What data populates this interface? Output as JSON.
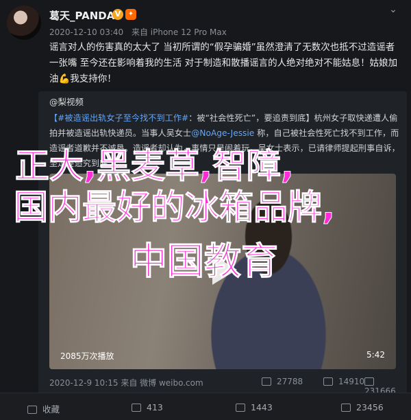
{
  "post": {
    "username": "葛天_PANDA",
    "verified_badge": "V",
    "level_badge": "✦",
    "time": "2020-12-10 03:40",
    "source": "来自 iPhone 12 Pro Max",
    "text": "谣言对人的伤害真的太大了 当初所谓的“假孕骗婚”虽然澄清了无数次也抵不过造谣者一张嘴 至今还在影响着我的生活 对于制造和散播谣言的人绝对绝对不能姑息！姑娘加油💪我支持你！"
  },
  "retweet": {
    "user": "@梨视频",
    "text_tag": "【#被造谣出轨女子至今找不到工作#",
    "text_body": "：被“社会性死亡”，要追责到底】杭州女子取快递遭人偷拍并被造谣出轨快递员。当事人吴女士",
    "mention": "@NoAge-Jessie",
    "text_rest": " 称，自己被社会性死亡找不到工作，而造谣者道歉并不诚恳。造谣者却认为，事情只是闹着玩。吴女士表示，已请律师提起刑事自诉，坚定要追究到底",
    "video": {
      "views": "2085万次播放",
      "duration": "5:42"
    },
    "time": "2020-12-9 10:15 来自 微博 weibo.com",
    "reposts": "27788",
    "comments": "14910",
    "likes": "231666"
  },
  "overlay": {
    "line1": "正大,黑麦草,智障,",
    "line2": "国内最好的冰箱品牌,",
    "line3": "中国教育"
  },
  "actions": {
    "repost": "收藏",
    "comment": "413",
    "like": "1443",
    "share": "23456"
  }
}
